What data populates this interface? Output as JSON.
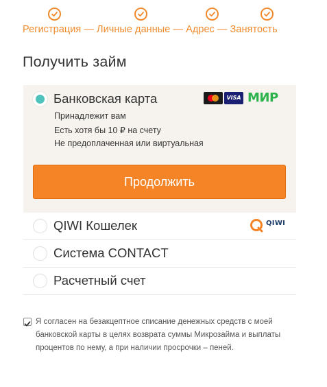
{
  "steps": {
    "labels_text": "Регистрация — Личные данные — Адрес — Занятость",
    "items": [
      "Регистрация",
      "Личные данные",
      "Адрес",
      "Занятость"
    ]
  },
  "title": "Получить займ",
  "methods": {
    "selected": {
      "label": "Банковская карта",
      "details": [
        "Принадлежит вам",
        "Есть хотя бы 10 ₽ на счету",
        "Не предоплаченная или виртуальная"
      ],
      "continue_label": "Продолжить",
      "logos": {
        "visa": "VISA",
        "mir": "МИР"
      }
    },
    "others": [
      {
        "label": "QIWI Кошелек",
        "logo": "QIWI"
      },
      {
        "label": "Система CONTACT"
      },
      {
        "label": "Расчетный счет"
      }
    ]
  },
  "consent": {
    "checked": true,
    "text": "Я согласен на безакцептное списание денежных средств с моей банковской карты в целях возврата суммы Микрозайма и выплаты процентов по нему, а при наличии просрочки – пеней."
  },
  "colors": {
    "accent": "#f08a2c",
    "button": "#f58426",
    "radio": "#4fc3bb",
    "mir_green": "#2bb24c",
    "qiwi_orange": "#f58426"
  }
}
